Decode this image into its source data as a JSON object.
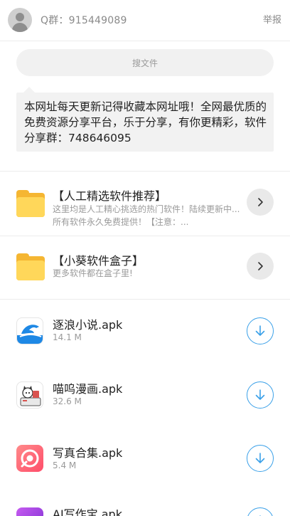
{
  "header": {
    "group_label": "Q群：915449089",
    "report_label": "举报"
  },
  "search": {
    "placeholder": "搜文件"
  },
  "notice": {
    "text": "本网址每天更新记得收藏本网址哦！全网最优质的免费资源分享平台，乐于分享，有你更精彩，软件分享群：748646095"
  },
  "folders": [
    {
      "title": "【人工精选软件推荐】",
      "desc": "这里均是人工精心挑选的热门软件！陆续更新中...所有软件永久免费提供！【注意：..."
    },
    {
      "title": "【小葵软件盒子】",
      "desc": "更多软件都在盒子里!"
    }
  ],
  "files": [
    {
      "name": "逐浪小说.apk",
      "size": "14.1 M",
      "icon": "dolphin-app-icon",
      "color": "#1e88e5"
    },
    {
      "name": "喵呜漫画.apk",
      "size": "32.6 M",
      "icon": "manga-app-icon",
      "color": "#d9534f"
    },
    {
      "name": "写真合集.apk",
      "size": "5.4 M",
      "icon": "photo-app-icon",
      "color": "#ff5a6e"
    },
    {
      "name": "AI写作宝.apk",
      "size": "",
      "icon": "writing-app-icon",
      "color": "#9b3fd6"
    }
  ],
  "colors": {
    "accent": "#3aa0e8",
    "folder": "#ffd75a"
  }
}
